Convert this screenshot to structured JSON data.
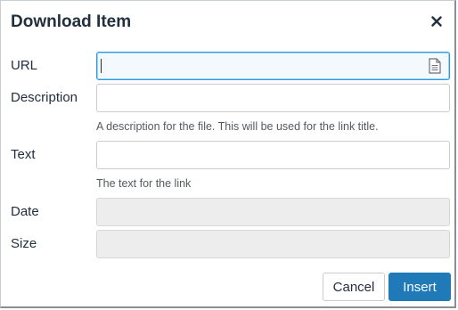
{
  "dialog": {
    "title": "Download Item",
    "close_icon": "close-icon"
  },
  "fields": {
    "url": {
      "label": "URL",
      "value": "",
      "icon": "file-icon"
    },
    "description": {
      "label": "Description",
      "value": "",
      "help": "A description for the file. This will be used for the link title."
    },
    "text": {
      "label": "Text",
      "value": "",
      "help": "The text for the link"
    },
    "date": {
      "label": "Date",
      "value": ""
    },
    "size": {
      "label": "Size",
      "value": ""
    }
  },
  "buttons": {
    "cancel": "Cancel",
    "insert": "Insert"
  },
  "colors": {
    "primary": "#207ab7",
    "focus_border": "#2d9be0",
    "disabled_bg": "#ededed"
  }
}
